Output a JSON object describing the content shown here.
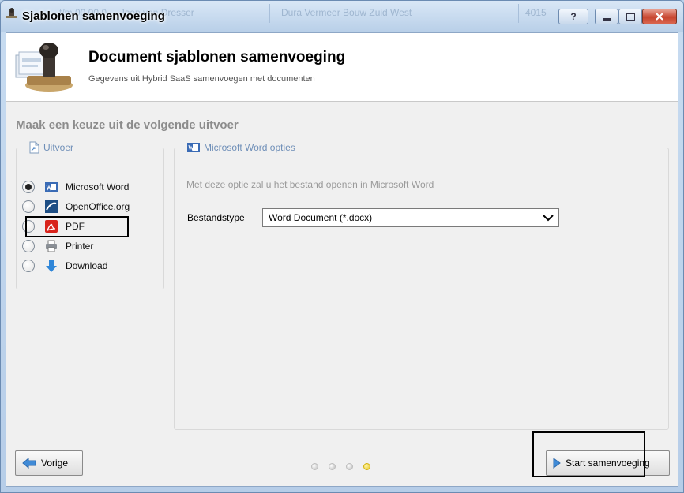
{
  "window": {
    "title": "Sjablonen samenvoeging",
    "background_tabs": [
      "t/m 00 00 0 ... Joop van Dresser",
      "Dura Vermeer Bouw Zuid West",
      "4015"
    ],
    "controls": [
      "help",
      "minimize",
      "maximize",
      "close"
    ]
  },
  "header": {
    "title": "Document sjablonen samenvoeging",
    "subtitle": "Gegevens uit Hybrid SaaS samenvoegen met documenten",
    "icon": "stamp-icon"
  },
  "section": {
    "title": "Maak een keuze uit de volgende uitvoer"
  },
  "output_group": {
    "legend": "Uitvoer",
    "options": [
      {
        "label": "Microsoft Word",
        "icon": "word-icon",
        "selected": true
      },
      {
        "label": "OpenOffice.org",
        "icon": "openoffice-icon",
        "selected": false
      },
      {
        "label": "PDF",
        "icon": "pdf-icon",
        "selected": false
      },
      {
        "label": "Printer",
        "icon": "printer-icon",
        "selected": false
      },
      {
        "label": "Download",
        "icon": "download-icon",
        "selected": false
      }
    ]
  },
  "word_options": {
    "legend": "Microsoft Word opties",
    "description": "Met deze optie zal u het bestand openen in Microsoft Word",
    "filetype_label": "Bestandstype",
    "filetype_value": "Word Document (*.docx)"
  },
  "footer": {
    "back_label": "Vorige",
    "start_label": "Start samenvoeging",
    "steps_total": 4,
    "current_step": 4
  },
  "colors": {
    "accent": "#6f8fb8",
    "active_step": "#e5c21a",
    "close_button": "#c7452f"
  }
}
